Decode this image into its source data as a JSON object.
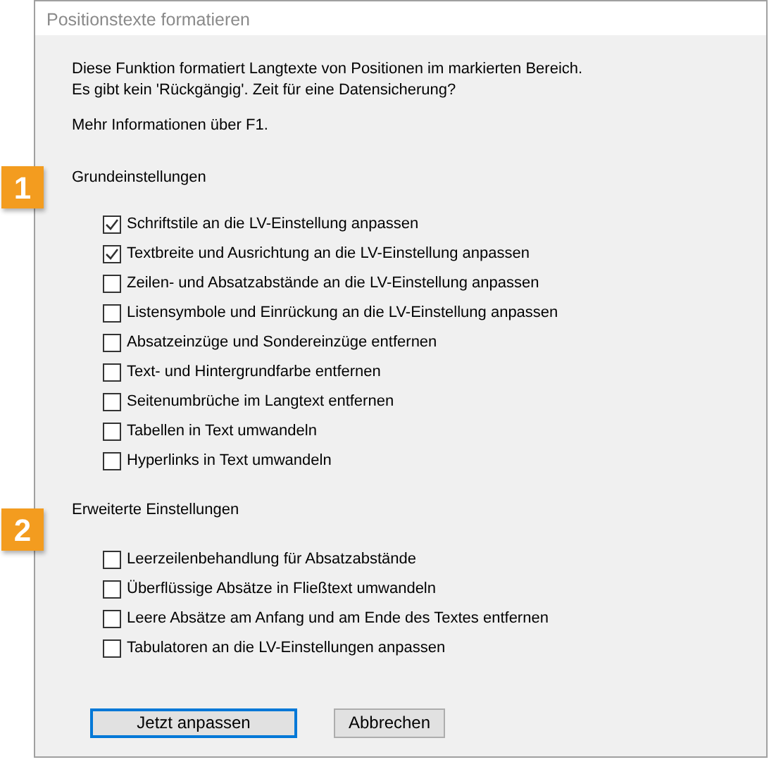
{
  "window": {
    "title": "Positionstexte formatieren"
  },
  "intro": [
    "Diese Funktion formatiert Langtexte von Positionen im markierten Bereich.",
    "Es gibt kein 'Rückgängig'. Zeit für eine Datensicherung?"
  ],
  "help": "Mehr Informationen über F1.",
  "sections": [
    {
      "badge": "1",
      "title": "Grundeinstellungen",
      "options": [
        {
          "label": "Schriftstile an die LV-Einstellung anpassen",
          "checked": true
        },
        {
          "label": "Textbreite und Ausrichtung an die LV-Einstellung anpassen",
          "checked": true
        },
        {
          "label": "Zeilen- und Absatzabstände an die LV-Einstellung anpassen",
          "checked": false
        },
        {
          "label": "Listensymbole und Einrückung an die LV-Einstellung anpassen",
          "checked": false
        },
        {
          "label": "Absatzeinzüge und Sondereinzüge entfernen",
          "checked": false
        },
        {
          "label": "Text- und Hintergrundfarbe entfernen",
          "checked": false
        },
        {
          "label": "Seitenumbrüche im Langtext entfernen",
          "checked": false
        },
        {
          "label": "Tabellen in Text umwandeln",
          "checked": false
        },
        {
          "label": "Hyperlinks in Text umwandeln",
          "checked": false
        }
      ]
    },
    {
      "badge": "2",
      "title": "Erweiterte Einstellungen",
      "options": [
        {
          "label": "Leerzeilenbehandlung für Absatzabstände",
          "checked": false
        },
        {
          "label": "Überflüssige Absätze in Fließtext umwandeln",
          "checked": false
        },
        {
          "label": "Leere Absätze am Anfang und am Ende des Textes entfernen",
          "checked": false
        },
        {
          "label": "Tabulatoren an die LV-Einstellungen anpassen",
          "checked": false
        }
      ]
    }
  ],
  "buttons": [
    {
      "label": "Jetzt anpassen",
      "default": true
    },
    {
      "label": "Abbrechen",
      "default": false
    }
  ]
}
